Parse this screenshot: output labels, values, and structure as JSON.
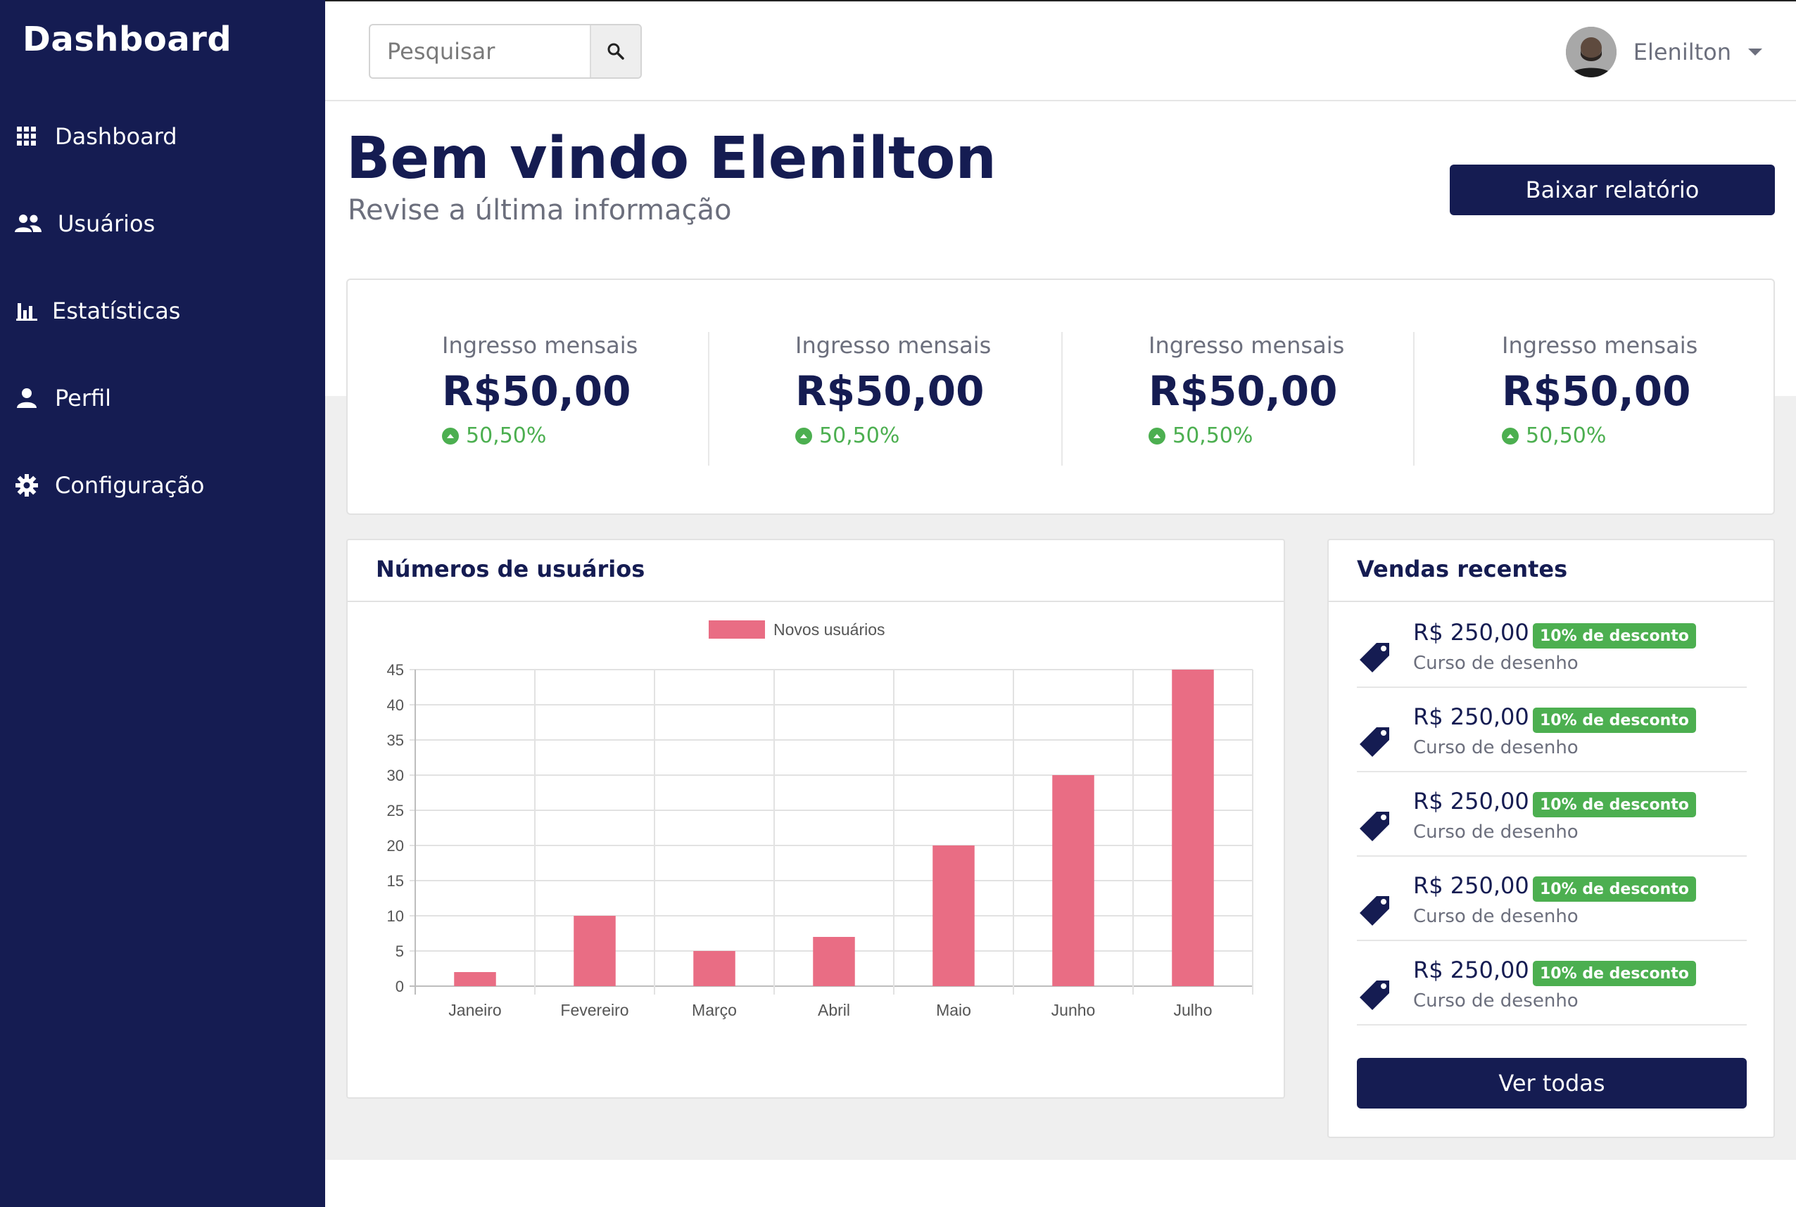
{
  "sidebar": {
    "brand": "Dashboard",
    "items": [
      {
        "label": "Dashboard",
        "icon": "grid-icon"
      },
      {
        "label": "Usuários",
        "icon": "users-icon"
      },
      {
        "label": "Estatísticas",
        "icon": "bar-chart-icon"
      },
      {
        "label": "Perfil",
        "icon": "person-icon"
      },
      {
        "label": "Configuração",
        "icon": "gear-icon"
      }
    ]
  },
  "header": {
    "search_placeholder": "Pesquisar",
    "user_name": "Elenilton"
  },
  "main": {
    "title": "Bem vindo Elenilton",
    "subtitle": "Revise a última informação",
    "report_button": "Baixar relatório"
  },
  "stats": [
    {
      "label": "Ingresso mensais",
      "value": "R$50,00",
      "change": "50,50%"
    },
    {
      "label": "Ingresso mensais",
      "value": "R$50,00",
      "change": "50,50%"
    },
    {
      "label": "Ingresso mensais",
      "value": "R$50,00",
      "change": "50,50%"
    },
    {
      "label": "Ingresso mensais",
      "value": "R$50,00",
      "change": "50,50%"
    }
  ],
  "chart_card": {
    "title": "Números de usuários"
  },
  "chart_data": {
    "type": "bar",
    "categories": [
      "Janeiro",
      "Fevereiro",
      "Março",
      "Abril",
      "Maio",
      "Junho",
      "Julho"
    ],
    "series": [
      {
        "name": "Novos usuários",
        "values": [
          2,
          10,
          5,
          7,
          20,
          30,
          45
        ]
      }
    ],
    "y_ticks": [
      0,
      5,
      10,
      15,
      20,
      25,
      30,
      35,
      40,
      45
    ],
    "ylim": [
      0,
      45
    ],
    "grid": true,
    "legend": "top-center",
    "bar_color": "#e96d84"
  },
  "sales": {
    "title": "Vendas recentes",
    "items": [
      {
        "price": "R$ 250,00",
        "badge": "10% de desconto",
        "description": "Curso de desenho"
      },
      {
        "price": "R$ 250,00",
        "badge": "10% de desconto",
        "description": "Curso de desenho"
      },
      {
        "price": "R$ 250,00",
        "badge": "10% de desconto",
        "description": "Curso de desenho"
      },
      {
        "price": "R$ 250,00",
        "badge": "10% de desconto",
        "description": "Curso de desenho"
      },
      {
        "price": "R$ 250,00",
        "badge": "10% de desconto",
        "description": "Curso de desenho"
      }
    ],
    "see_all": "Ver todas"
  },
  "colors": {
    "navy": "#151c52",
    "success": "#4caf50",
    "muted_text": "#6c6f7d",
    "bar": "#e96d84"
  }
}
